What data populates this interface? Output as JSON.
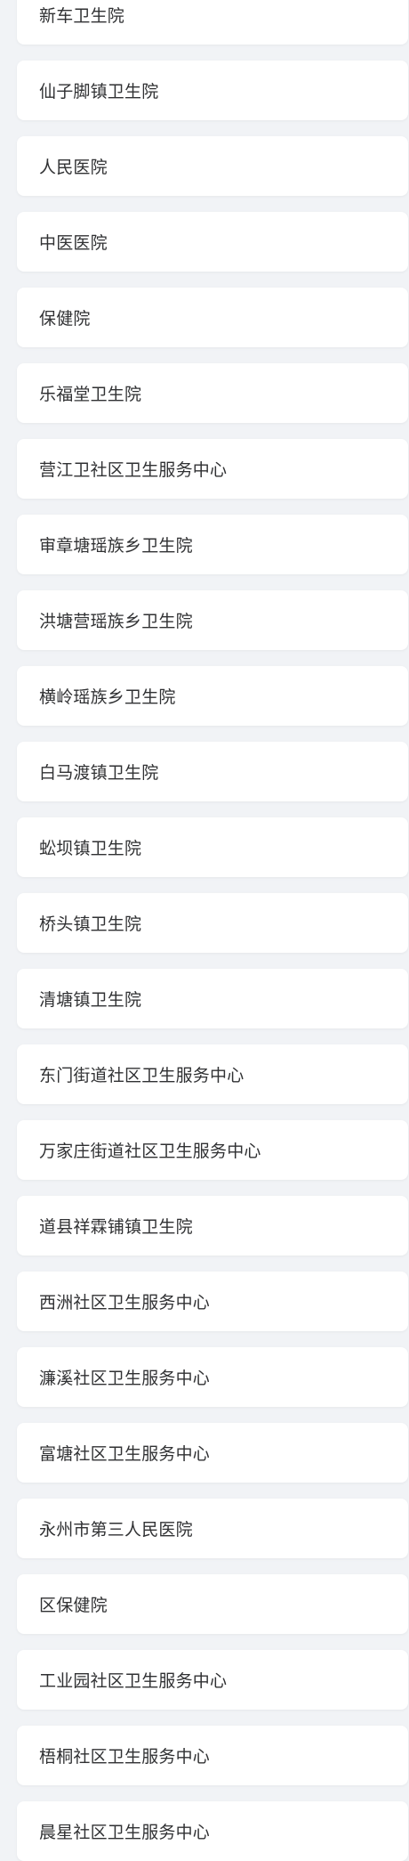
{
  "hospital_list": {
    "items": [
      "新车卫生院",
      "仙子脚镇卫生院",
      "人民医院",
      "中医医院",
      "保健院",
      "乐福堂卫生院",
      "营江卫社区卫生服务中心",
      "审章塘瑶族乡卫生院",
      "洪塘营瑶族乡卫生院",
      "横岭瑶族乡卫生院",
      "白马渡镇卫生院",
      "蚣坝镇卫生院",
      "桥头镇卫生院",
      "清塘镇卫生院",
      "东门街道社区卫生服务中心",
      "万家庄街道社区卫生服务中心",
      "道县祥霖铺镇卫生院",
      "西洲社区卫生服务中心",
      "濂溪社区卫生服务中心",
      "富塘社区卫生服务中心",
      "永州市第三人民医院",
      "区保健院",
      "工业园社区卫生服务中心",
      "梧桐社区卫生服务中心",
      "晨星社区卫生服务中心"
    ]
  }
}
